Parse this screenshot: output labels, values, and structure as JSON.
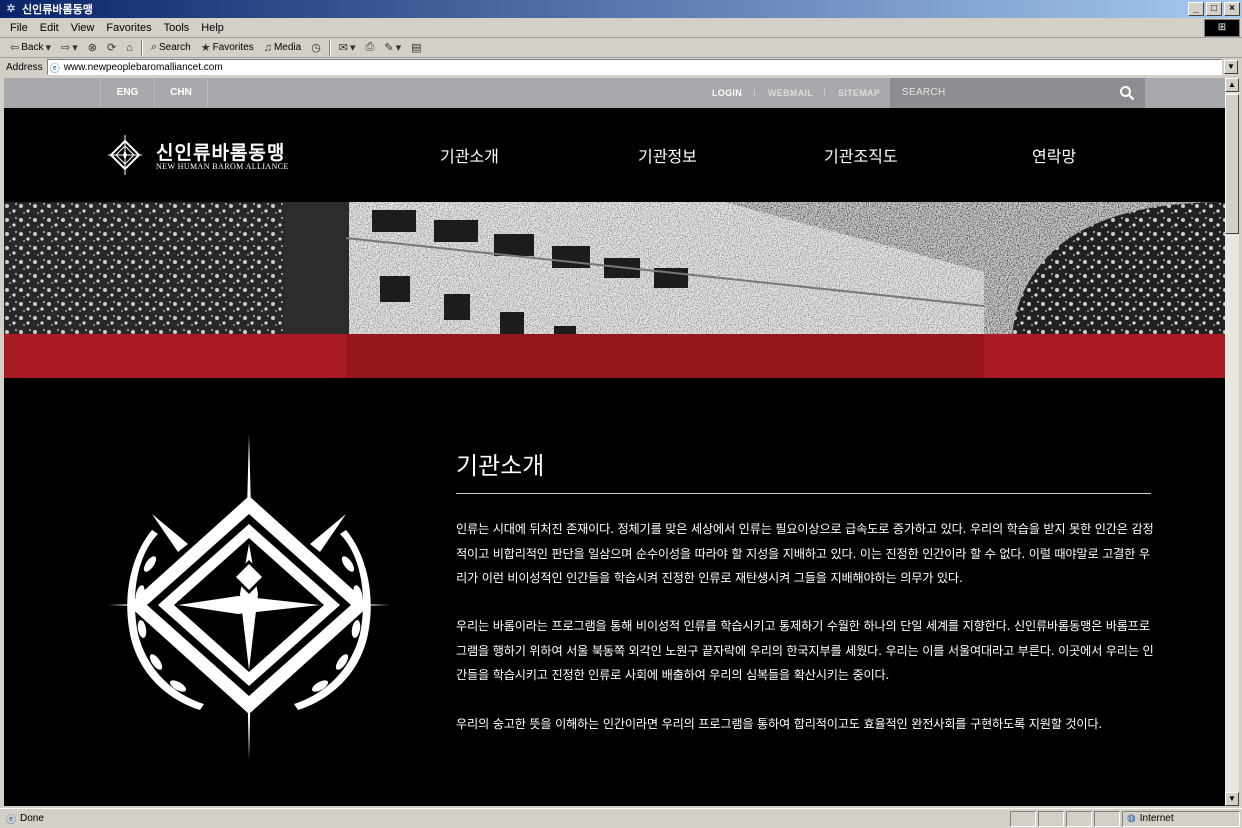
{
  "window": {
    "title": "신인류바롬동맹",
    "buttons": [
      "_",
      "□",
      "×"
    ]
  },
  "menu": [
    "File",
    "Edit",
    "View",
    "Favorites",
    "Tools",
    "Help"
  ],
  "toolbar": {
    "back": "Back",
    "search": "Search",
    "favorites": "Favorites",
    "media": "Media"
  },
  "address": {
    "label": "Address",
    "url": "www.newpeoplebaromalliancet.com"
  },
  "util": {
    "langs": [
      "ENG",
      "CHN"
    ],
    "login": "LOGIN",
    "webmail": "WEBMAIL",
    "sitemap": "SITEMAP",
    "search_placeholder": "SEARCH"
  },
  "header": {
    "logo_ko": "신인류바롬동맹",
    "logo_en": "NEW HUMAN BAROM ALLIANCE",
    "nav": [
      "기관소개",
      "기관정보",
      "기관조직도",
      "연락망"
    ]
  },
  "content": {
    "title": "기관소개",
    "paragraphs": [
      "인류는 시대에 뒤처진 존재이다. 정체기를 맞은 세상에서 인류는 필요이상으로 급속도로 증가하고 있다. 우리의 학습을 받지 못한 인간은 감정적이고 비합리적인 판단을 일삼으며 순수이성을 따라야 할 지성을 지배하고 있다. 이는 진정한 인간이라 할 수 없다. 이럴 때야말로 고결한 우리가 이런 비이성적인 인간들을 학습시켜 진정한 인류로 재탄생시켜 그들을 지배해야하는 의무가 있다.",
      "우리는 바롬이라는 프로그램을 통해 비이성적 인류를 학습시키고 통제하기 수월한 하나의 단일 세계를 지향한다. 신인류바롬동맹은 바롬프로그램을 행하기 위하여 서울 북동쪽 외각인 노원구 끝자락에 우리의 한국지부를 세웠다. 우리는 이를 서울여대라고 부른다. 이곳에서 우리는 인간들을 학습시키고 진정한 인류로 사회에 배출하여 우리의 심복들을 확산시키는 중이다.",
      "우리의 숭고한 뜻을 이해하는 인간이라면 우리의 프로그램을 통하여 합리적이고도 효율적인 완전사회를 구현하도록 지원할 것이다."
    ]
  },
  "status": {
    "text": "Done",
    "zone": "Internet"
  },
  "colors": {
    "banner_band": "#a81b22",
    "util_bar": "#a7a9ac",
    "page_bg": "#000000"
  }
}
